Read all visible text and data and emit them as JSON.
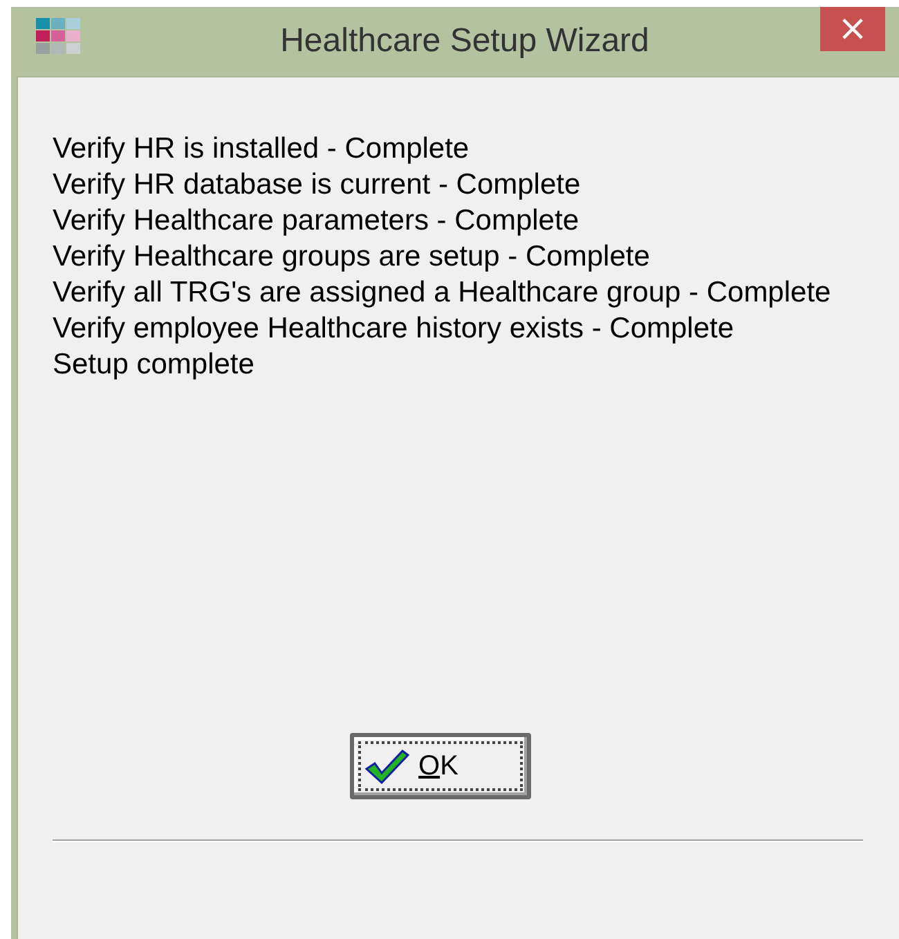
{
  "window": {
    "title": "Healthcare Setup Wizard",
    "close": "×"
  },
  "messages": [
    "Verify HR is installed - Complete",
    "Verify HR database is current - Complete",
    "Verify Healthcare parameters - Complete",
    "Verify Healthcare groups are setup - Complete",
    "Verify all TRG's are assigned a Healthcare group - Complete",
    "Verify employee Healthcare history exists - Complete",
    "Setup complete"
  ],
  "buttons": [
    {
      "label": "OK",
      "focused": true
    }
  ]
}
